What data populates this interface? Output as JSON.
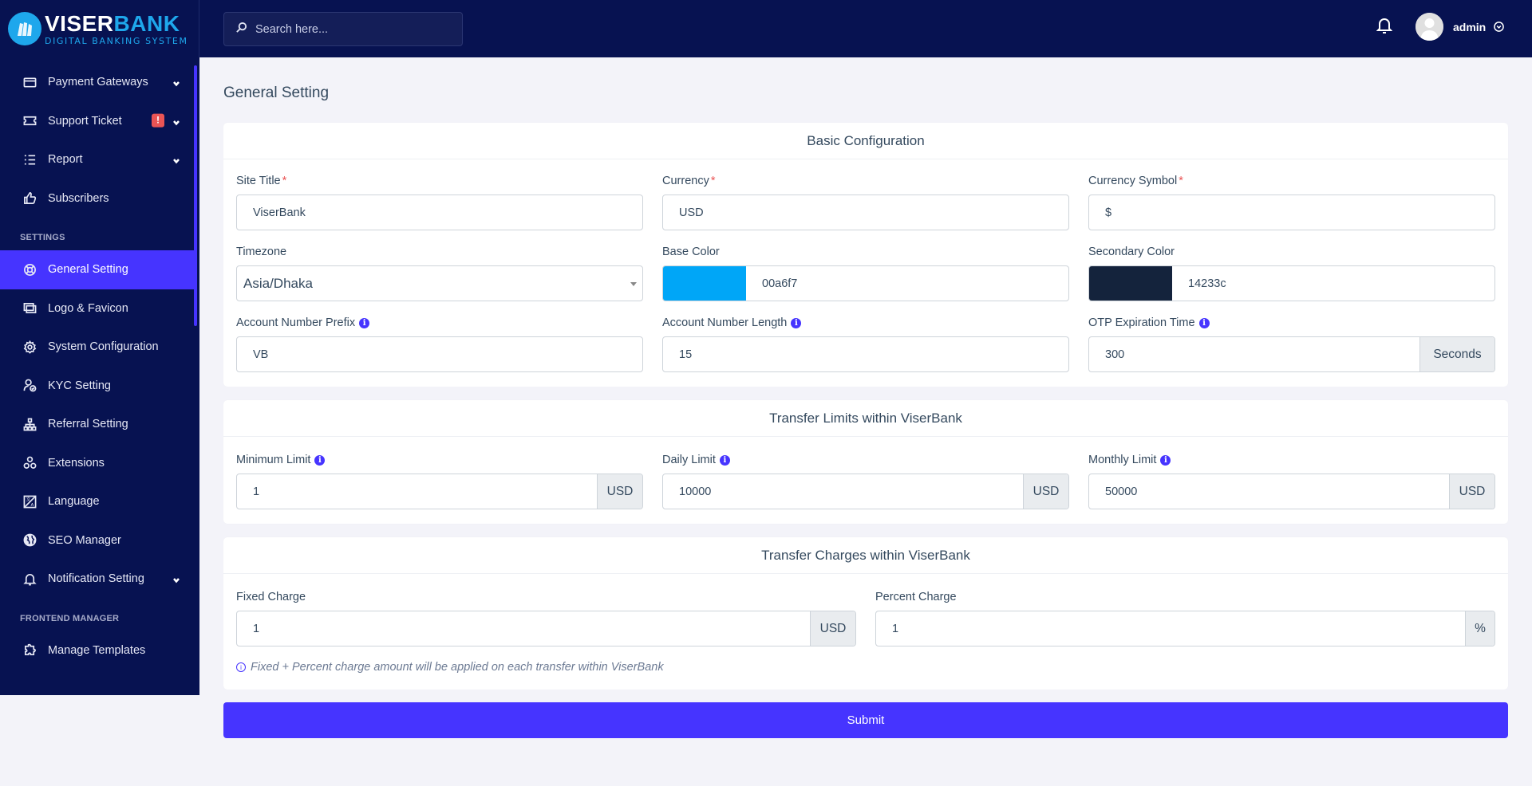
{
  "brand": {
    "name_part1": "VISER",
    "name_part2": "BANK",
    "tagline": "DIGITAL BANKING SYSTEM",
    "colors": {
      "primary": "#4634ff",
      "sidebar": "#071251",
      "logo": "#1ea7ec"
    }
  },
  "topbar": {
    "search_placeholder": "Search here...",
    "username": "admin"
  },
  "sidebar": {
    "items": [
      {
        "label": "Payment Gateways",
        "icon": "credit-card-icon",
        "has_caret": true
      },
      {
        "label": "Support Ticket",
        "icon": "ticket-icon",
        "has_caret": true,
        "badge": "!"
      },
      {
        "label": "Report",
        "icon": "list-icon",
        "has_caret": true
      },
      {
        "label": "Subscribers",
        "icon": "thumbs-up-icon"
      }
    ],
    "section_settings": "SETTINGS",
    "settings_items": [
      {
        "label": "General Setting",
        "icon": "life-ring-icon",
        "active": true
      },
      {
        "label": "Logo & Favicon",
        "icon": "images-icon"
      },
      {
        "label": "System Configuration",
        "icon": "gear-icon"
      },
      {
        "label": "KYC Setting",
        "icon": "user-check-icon"
      },
      {
        "label": "Referral Setting",
        "icon": "sitemap-icon"
      },
      {
        "label": "Extensions",
        "icon": "cubes-icon"
      },
      {
        "label": "Language",
        "icon": "language-icon"
      },
      {
        "label": "SEO Manager",
        "icon": "globe-icon"
      },
      {
        "label": "Notification Setting",
        "icon": "bell-icon",
        "has_caret": true
      }
    ],
    "section_frontend": "FRONTEND MANAGER",
    "frontend_items": [
      {
        "label": "Manage Templates",
        "icon": "puzzle-icon"
      }
    ]
  },
  "page": {
    "title": "General Setting",
    "basic": {
      "header": "Basic Configuration",
      "site_title": {
        "label": "Site Title",
        "value": "ViserBank"
      },
      "currency": {
        "label": "Currency",
        "value": "USD"
      },
      "currency_symbol": {
        "label": "Currency Symbol",
        "value": "$"
      },
      "timezone": {
        "label": "Timezone",
        "value": "Asia/Dhaka"
      },
      "base_color": {
        "label": "Base Color",
        "value": "00a6f7",
        "swatch": "#00a6f7"
      },
      "secondary_color": {
        "label": "Secondary Color",
        "value": "14233c",
        "swatch": "#14233c"
      },
      "account_prefix": {
        "label": "Account Number Prefix",
        "value": "VB"
      },
      "account_length": {
        "label": "Account Number Length",
        "value": "15"
      },
      "otp_expiration": {
        "label": "OTP Expiration Time",
        "value": "300",
        "addon": "Seconds"
      }
    },
    "limits": {
      "header": "Transfer Limits within ViserBank",
      "minimum": {
        "label": "Minimum Limit",
        "value": "1",
        "addon": "USD"
      },
      "daily": {
        "label": "Daily Limit",
        "value": "10000",
        "addon": "USD"
      },
      "monthly": {
        "label": "Monthly Limit",
        "value": "50000",
        "addon": "USD"
      }
    },
    "charges": {
      "header": "Transfer Charges within ViserBank",
      "fixed": {
        "label": "Fixed Charge",
        "value": "1",
        "addon": "USD"
      },
      "percent": {
        "label": "Percent Charge",
        "value": "1",
        "addon": "%"
      },
      "hint": "Fixed + Percent charge amount will be applied on each transfer within ViserBank"
    },
    "submit_label": "Submit"
  },
  "required_mark": "*",
  "info_glyph": "i"
}
